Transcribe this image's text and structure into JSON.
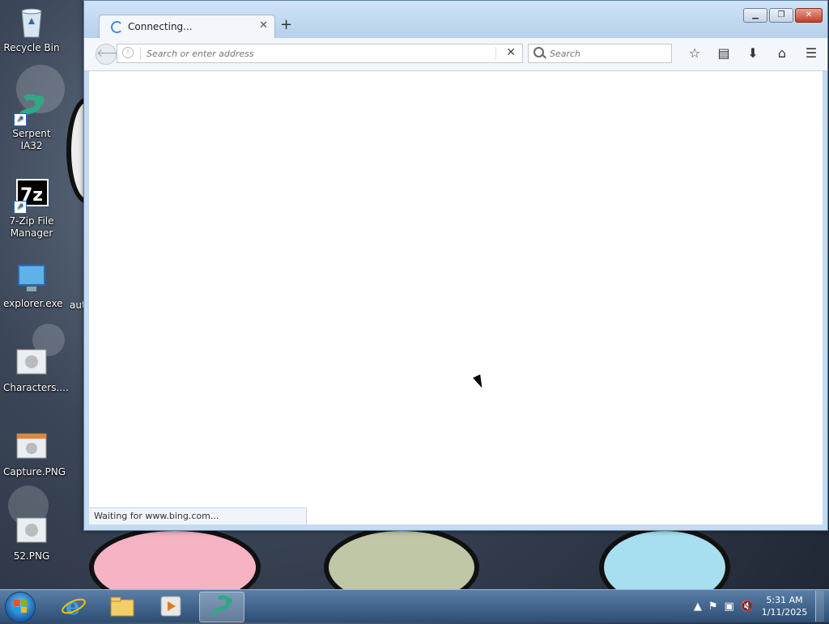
{
  "desktop": {
    "icons": [
      {
        "label": "Recycle Bin"
      },
      {
        "label": "Serpent IA32"
      },
      {
        "label": "7-Zip File Manager"
      },
      {
        "label": "explorer.exe"
      },
      {
        "label": "Characters...."
      },
      {
        "label": "Capture.PNG"
      },
      {
        "label": "52.PNG"
      }
    ],
    "partial_label": "aut"
  },
  "browser": {
    "tab": {
      "title": "Connecting..."
    },
    "urlbar": {
      "placeholder": "Search or enter address"
    },
    "searchbar": {
      "placeholder": "Search"
    },
    "status_text": "Waiting for www.bing.com..."
  },
  "taskbar": {
    "clock_time": "5:31 AM",
    "clock_date": "1/11/2025"
  },
  "colors": {
    "accent": "#3d8bdf",
    "taskbar": "#2e4d73"
  }
}
